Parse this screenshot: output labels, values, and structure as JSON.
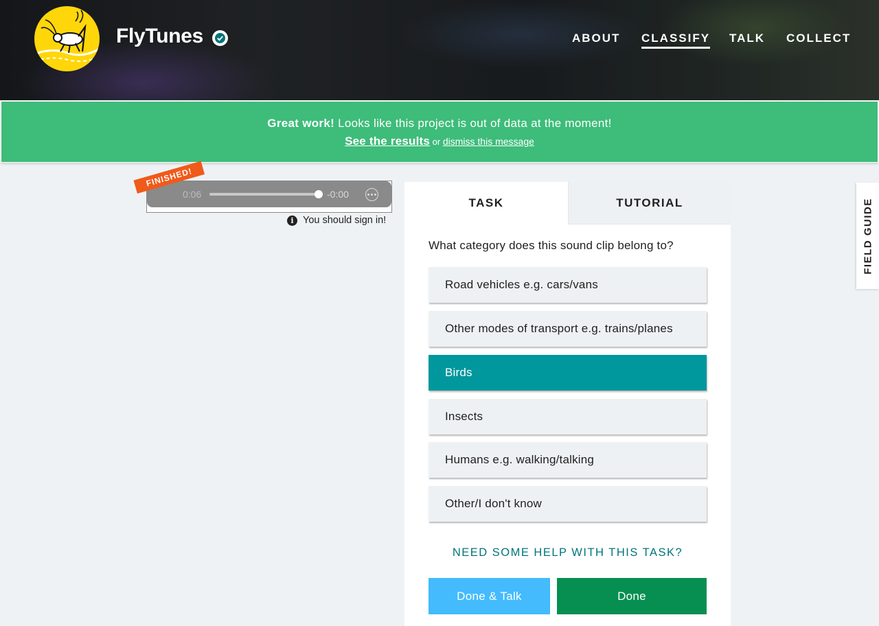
{
  "header": {
    "project_title": "FlyTunes",
    "nav": [
      {
        "label": "ABOUT"
      },
      {
        "label": "CLASSIFY",
        "active": true
      },
      {
        "label": "TALK"
      },
      {
        "label": "COLLECT"
      }
    ]
  },
  "banner": {
    "strong": "Great work!",
    "message": " Looks like this project is out of data at the moment!",
    "results_link": "See the results",
    "or": " or ",
    "dismiss_link": "dismiss this message",
    "color": "#3ebc7a"
  },
  "audio": {
    "current_time": "0:06",
    "remaining_time": "-0:00",
    "progress": 0.97,
    "ribbon": "FINISHED!"
  },
  "signin_notice": "You should sign in!",
  "task_panel": {
    "tabs": [
      {
        "label": "TASK",
        "active": true
      },
      {
        "label": "TUTORIAL"
      }
    ],
    "question": "What category does this sound clip belong to?",
    "answers": [
      {
        "label": "Road vehicles e.g. cars/vans"
      },
      {
        "label": "Other modes of transport e.g. trains/planes"
      },
      {
        "label": "Birds",
        "selected": true
      },
      {
        "label": "Insects"
      },
      {
        "label": "Humans e.g. walking/talking"
      },
      {
        "label": "Other/I don't know"
      }
    ],
    "help_link": "NEED SOME HELP WITH THIS TASK?",
    "done_talk_label": "Done & Talk",
    "done_label": "Done",
    "selected_color": "#00979d"
  },
  "field_guide_label": "FIELD GUIDE",
  "icons": {
    "verified": "verified-check-icon",
    "info": "info-icon",
    "more": "more-options-icon"
  }
}
